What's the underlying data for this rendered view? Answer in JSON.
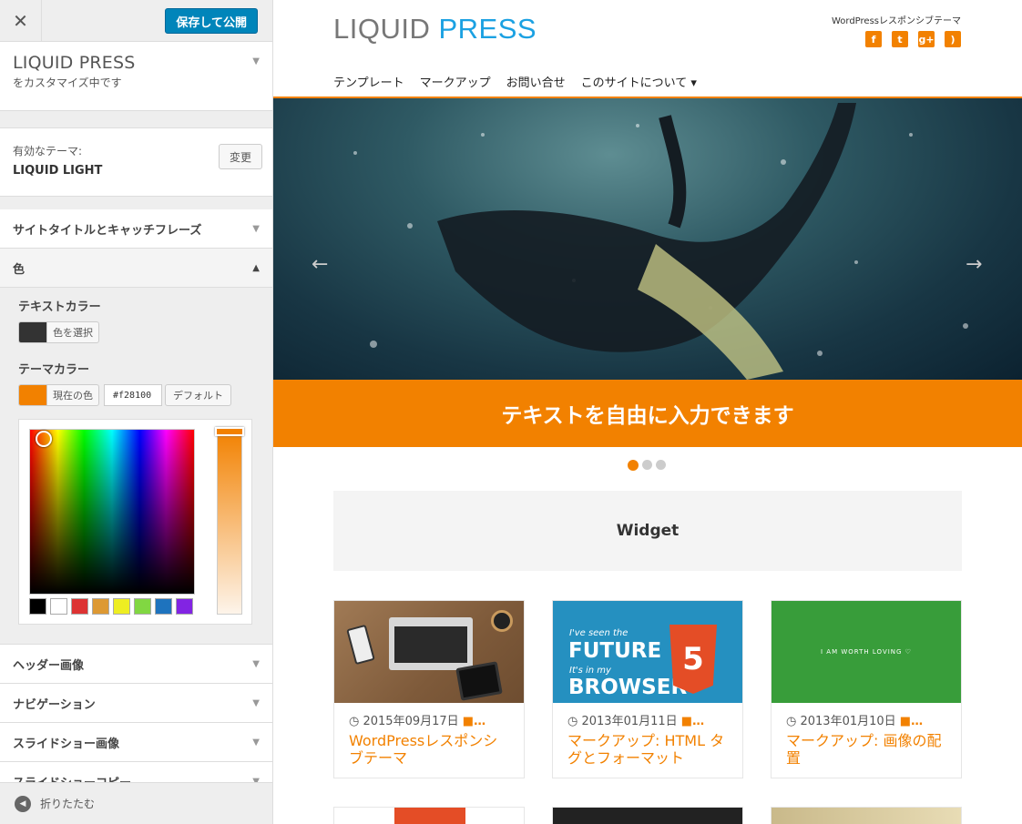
{
  "sidebar": {
    "close_symbol": "✕",
    "publish_label": "保存して公開",
    "site_name": "LIQUID PRESS",
    "customizing_text": "をカスタマイズ中です",
    "active_theme_label": "有効なテーマ:",
    "active_theme_name": "LIQUID LIGHT",
    "change_button": "変更",
    "sections_top": [
      {
        "label": "サイトタイトルとキャッチフレーズ"
      },
      {
        "label": "色"
      }
    ],
    "colors": {
      "text_color_title": "テキストカラー",
      "text_color_value": "#333333",
      "select_color_label": "色を選択",
      "theme_color_title": "テーマカラー",
      "theme_color_value": "#f28100",
      "current_color_label": "現在の色",
      "hex_value": "#f28100",
      "default_label": "デフォルト",
      "palette": [
        "#000000",
        "#ffffff",
        "#dd3333",
        "#dd9933",
        "#eeee22",
        "#81d742",
        "#1e73be",
        "#8224e3"
      ]
    },
    "sections_bottom": [
      {
        "label": "ヘッダー画像"
      },
      {
        "label": "ナビゲーション"
      },
      {
        "label": "スライドショー画像"
      },
      {
        "label": "スライドショーコピー"
      }
    ],
    "collapse_label": "折りたたむ"
  },
  "preview": {
    "logo_part1": "LIQUID",
    "logo_part2": "PRESS",
    "tagline": "WordPressレスポンシブテーマ",
    "social_icons": [
      "facebook-icon",
      "twitter-icon",
      "googleplus-icon",
      "rss-icon"
    ],
    "nav": [
      "テンプレート",
      "マークアップ",
      "お問い合せ",
      "このサイトについて ▾"
    ],
    "slide_caption": "テキストを自由に入力できます",
    "slider_dots": 3,
    "slider_active": 1,
    "widget_title": "Widget",
    "posts": [
      {
        "date": "2015年09月17日",
        "title": "WordPressレスポンシブテーマ"
      },
      {
        "date": "2013年01月11日",
        "title": "マークアップ: HTML タグとフォーマット",
        "thumb_lines": [
          "I've seen the",
          "FUTURE",
          "It's in my",
          "BROWSER"
        ],
        "thumb_badge": "5"
      },
      {
        "date": "2013年01月10日",
        "title": "マークアップ: 画像の配置",
        "thumb_text": "I AM WORTH LOVING ♡"
      }
    ],
    "accent_color": "#f28100",
    "logo_blue": "#1ba1e2"
  }
}
